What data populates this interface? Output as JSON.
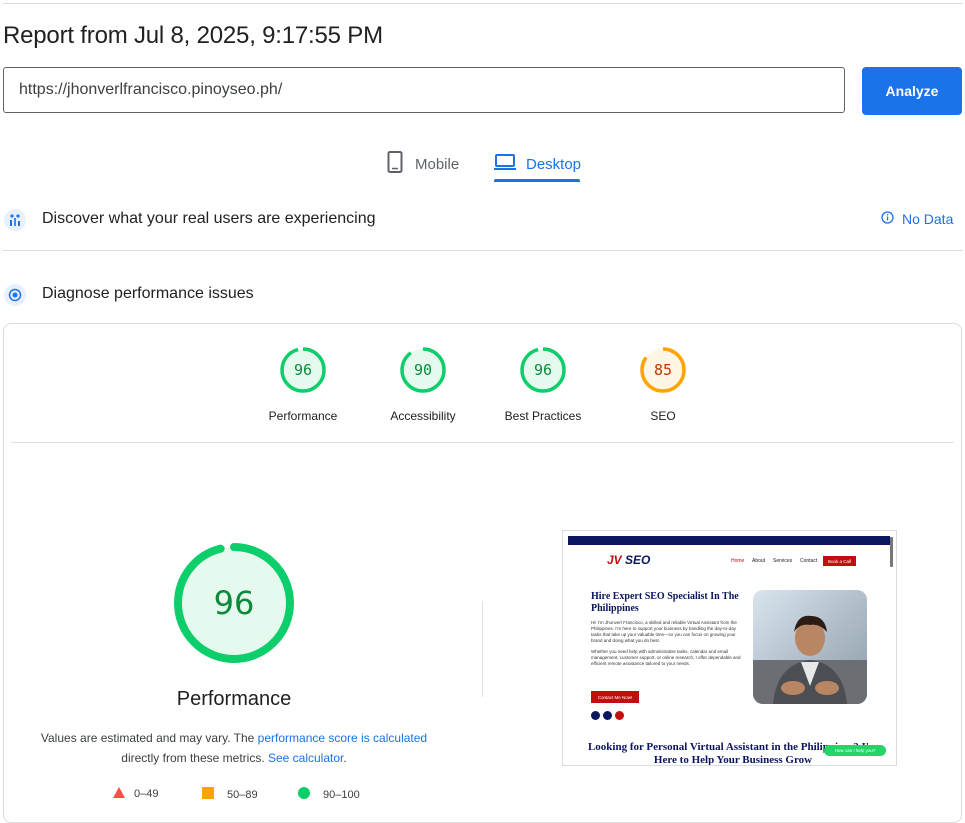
{
  "report_title": "Report from Jul 8, 2025, 9:17:55 PM",
  "url_input": {
    "value": "https://jhonverlfrancisco.pinoyseo.ph/"
  },
  "analyze_label": "Analyze",
  "tabs": {
    "mobile": "Mobile",
    "desktop": "Desktop",
    "active": "desktop"
  },
  "field_data": {
    "title": "Discover what your real users are experiencing",
    "status": "No Data"
  },
  "diagnose": {
    "title": "Diagnose performance issues"
  },
  "categories": [
    {
      "label": "Performance",
      "score": "96",
      "status": "pass"
    },
    {
      "label": "Accessibility",
      "score": "90",
      "status": "pass"
    },
    {
      "label": "Best Practices",
      "score": "96",
      "status": "pass"
    },
    {
      "label": "SEO",
      "score": "85",
      "status": "average"
    }
  ],
  "main_gauge": {
    "score": "96",
    "title": "Performance"
  },
  "note": {
    "prefix": "Values are estimated and may vary. The ",
    "link1": "performance score is calculated",
    "middle": " directly from these metrics. ",
    "link2": "See calculator",
    "suffix": "."
  },
  "legend": {
    "fail": "0–49",
    "average": "50–89",
    "pass": "90–100"
  },
  "colors": {
    "accent": "#1a73e8",
    "pass": "#0cce6b",
    "average": "#ffa400",
    "fail": "#ff4e42"
  },
  "preview": {
    "logo_left": "JV",
    "logo_right": "SEO",
    "nav": [
      "Home",
      "About",
      "Services",
      "Contact"
    ],
    "book_call": "Book a Call",
    "headline": "Hire Expert SEO Specialist In The Philippines",
    "intro": "Hi! I'm Jhonverl Francisco, a skilled and reliable Virtual Assistant from the Philippines. I'm here to support your business by handling the day-to-day tasks that take up your valuable time—so you can focus on growing your brand and doing what you do best.",
    "intro2": "Whether you need help with administrative tasks, calendar and email management, customer support, or online research, I offer dependable and efficient remote assistance tailored to your needs.",
    "cta": "Contact Me Now!",
    "subheadline": "Looking for Personal Virtual Assistant in the Philippines? I'm Here to Help Your Business Grow",
    "chat": "How can I help you?"
  }
}
